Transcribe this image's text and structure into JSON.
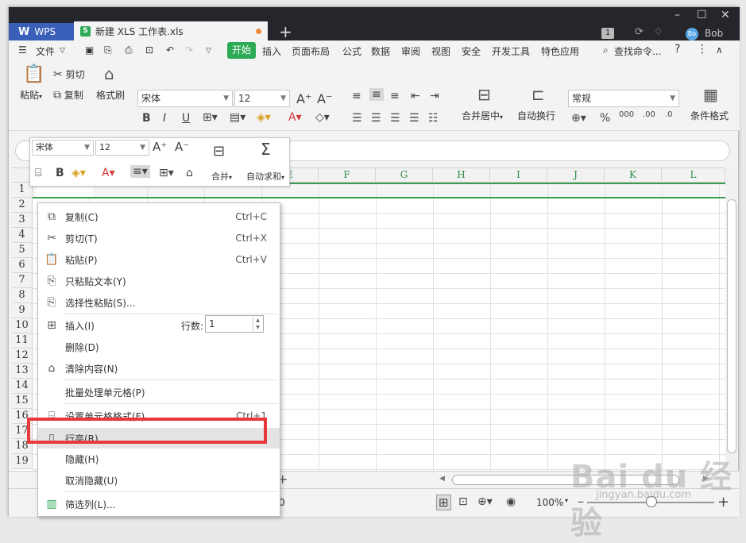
{
  "titlebar": {
    "wps_label": "WPS",
    "doc_tab": "新建 XLS 工作表.xls",
    "sheet_glyph": "S",
    "badge": "1",
    "avatar": "Bo",
    "user": "Bob"
  },
  "menu": {
    "file": "文件",
    "items": [
      "开始",
      "插入",
      "页面布局",
      "公式",
      "数据",
      "审阅",
      "视图",
      "安全",
      "开发工具",
      "特色应用"
    ],
    "search": "查找命令..."
  },
  "ribbon": {
    "paste": "粘贴",
    "cut": "剪切",
    "copy": "复制",
    "format_painter": "格式刷",
    "font": "宋体",
    "size": "12",
    "merge": "合并居中",
    "wrap": "自动换行",
    "number_format": "常规",
    "conditional": "条件格式"
  },
  "mini_toolbar": {
    "font": "宋体",
    "size": "12",
    "merge": "合并",
    "autosum": "自动求和"
  },
  "columns": [
    "E",
    "F",
    "G",
    "H",
    "I",
    "J",
    "K",
    "L"
  ],
  "rows": [
    "1",
    "2",
    "3",
    "4",
    "5",
    "6",
    "7",
    "8",
    "9",
    "10",
    "11",
    "12",
    "13",
    "14",
    "15",
    "16",
    "17",
    "18",
    "19"
  ],
  "context_menu": {
    "copy": "复制(C)",
    "copy_sc": "Ctrl+C",
    "cut": "剪切(T)",
    "cut_sc": "Ctrl+X",
    "paste": "粘贴(P)",
    "paste_sc": "Ctrl+V",
    "paste_text": "只粘贴文本(Y)",
    "paste_special": "选择性粘贴(S)...",
    "insert": "插入(I)",
    "rows_label": "行数:",
    "rows_value": "1",
    "delete": "删除(D)",
    "clear": "清除内容(N)",
    "batch": "批量处理单元格(P)",
    "format_cells": "设置单元格格式(F)...",
    "format_cells_sc": "Ctrl+1",
    "row_height": "行高(R)...",
    "hide": "隐藏(H)",
    "unhide": "取消隐藏(U)",
    "filter_col": "筛选列(L)..."
  },
  "status": {
    "sum": "=0",
    "zoom": "100%"
  },
  "watermark": {
    "text": "Bai du 经验",
    "url": "jingyan.baidu.com"
  },
  "colors": {
    "accent": "#2daa56",
    "highlight": "#e83a3a",
    "titlebar": "#25262c"
  }
}
